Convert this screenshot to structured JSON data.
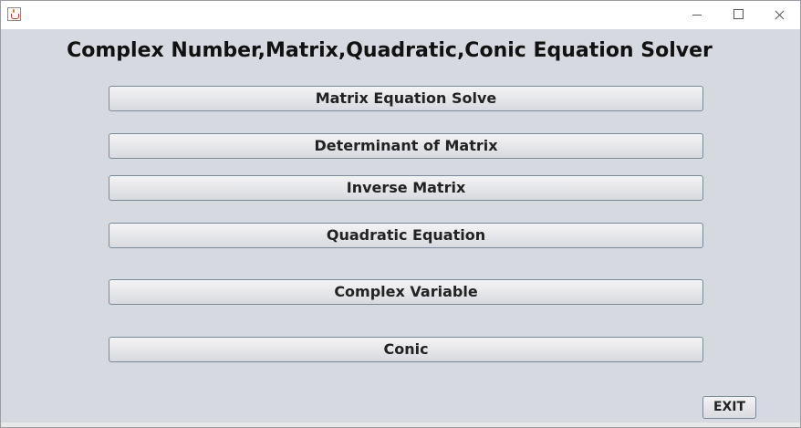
{
  "window": {
    "controls": {
      "minimize_icon": "minimize-icon",
      "maximize_icon": "maximize-icon",
      "close_icon": "close-icon"
    }
  },
  "main": {
    "title": "Complex Number,Matrix,Quadratic,Conic Equation Solver",
    "buttons": [
      {
        "label": "Matrix Equation Solve"
      },
      {
        "label": "Determinant of Matrix"
      },
      {
        "label": "Inverse Matrix"
      },
      {
        "label": "Quadratic Equation"
      },
      {
        "label": "Complex Variable"
      },
      {
        "label": "Conic"
      }
    ],
    "exit_label": "EXIT"
  },
  "colors": {
    "background": "#d7d9e0",
    "button_border": "#7a8a99",
    "text": "#111111"
  }
}
